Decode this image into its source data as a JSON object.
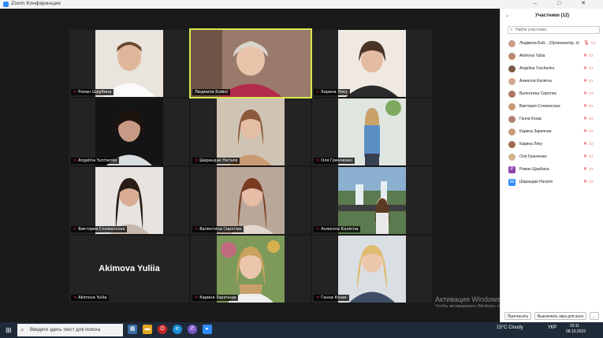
{
  "window": {
    "title": "Zoom Конференция",
    "controls": [
      "–",
      "□",
      "✕"
    ]
  },
  "tiles": [
    {
      "name": "Роман Щербина"
    },
    {
      "name": "Людмила Бойко",
      "active": true
    },
    {
      "name": "Карина Ляху"
    },
    {
      "name": "Angelina Yurchenko"
    },
    {
      "name": "Шарандак Наталя"
    },
    {
      "name": "Оля Гринченко"
    },
    {
      "name": "Виктория Сложенская"
    },
    {
      "name": "Валентина Сиротюк"
    },
    {
      "name": "Анжелла Калягна"
    },
    {
      "name": "Akimova Yuliia",
      "big_name": "Akimova Yuliia"
    },
    {
      "name": "Карина Заричная"
    },
    {
      "name": "Ганна Козак"
    }
  ],
  "watermark": {
    "title": "Активация Windows",
    "subtitle": "Чтобы активировать Windows, перейдите в раздел \"Параметры\"."
  },
  "participants_panel": {
    "title": "Участники (12)",
    "search_placeholder": "Найти участника",
    "participants": [
      {
        "name": "Людмила Бой... (Организатор, я)",
        "avatar": "photo"
      },
      {
        "name": "Akimova Yuliia",
        "avatar": "photo"
      },
      {
        "name": "Angelina Yurchenko",
        "avatar": "photo"
      },
      {
        "name": "Анжелла Калягна",
        "avatar": "photo"
      },
      {
        "name": "Валентина Сиротюк",
        "avatar": "photo"
      },
      {
        "name": "Виктория Сложенская",
        "avatar": "photo"
      },
      {
        "name": "Ганна Козак",
        "avatar": "photo"
      },
      {
        "name": "Карина Заричная",
        "avatar": "photo"
      },
      {
        "name": "Карина Ляху",
        "avatar": "photo"
      },
      {
        "name": "Оля Гринченко",
        "avatar": "photo"
      },
      {
        "name": "Роман Щербина",
        "avatar": "letter",
        "letter": "Р"
      },
      {
        "name": "Шарандак Наталя",
        "avatar": "letter",
        "letter": "Ш"
      }
    ],
    "invite_label": "Пригласить",
    "mute_all_label": "Выключить звук для всех",
    "more_label": "..."
  },
  "taskbar": {
    "search_placeholder": "Введите здесь текст для поиска",
    "weather": "15°C  Cloudy",
    "language": "УКР",
    "time": "20:11",
    "date": "08.10.2022"
  }
}
